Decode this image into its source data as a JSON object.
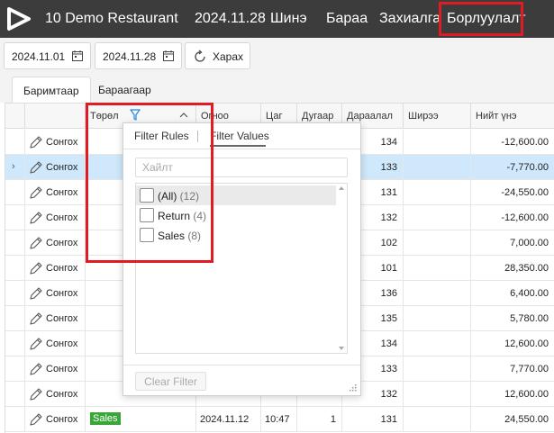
{
  "header": {
    "app_title": "10 Demo Restaurant",
    "date": "2024.11.28",
    "nav": [
      {
        "label": "Шинэ"
      },
      {
        "label": "Бараа"
      },
      {
        "label": "Захиалга"
      },
      {
        "label": "Борлуулалт"
      }
    ],
    "active_nav_index": 3
  },
  "toolbar": {
    "start_date": "2024.11.01",
    "end_date": "2024.11.28",
    "refresh_label": "Харах"
  },
  "tabs": [
    {
      "label": "Баримтаар",
      "active": true
    },
    {
      "label": "Бараагаар",
      "active": false
    }
  ],
  "grid": {
    "columns": [
      "",
      "",
      "Төрөл",
      "Огноо",
      "Цаг",
      "Дугаар",
      "Дараалал",
      "Ширээ",
      "Нийт үнэ"
    ],
    "edit_label": "Сонгох",
    "rows": [
      {
        "table": "134",
        "total": "-12,600.00"
      },
      {
        "table": "133",
        "total": "-7,770.00",
        "selected": true
      },
      {
        "table": "131",
        "total": "-24,550.00"
      },
      {
        "table": "132",
        "total": "-12,600.00"
      },
      {
        "table": "102",
        "total": "7,000.00"
      },
      {
        "table": "101",
        "total": "28,350.00"
      },
      {
        "table": "136",
        "total": "6,400.00"
      },
      {
        "table": "135",
        "total": "5,780.00"
      },
      {
        "table": "134",
        "total": "12,600.00"
      },
      {
        "table": "133",
        "total": "7,770.00"
      },
      {
        "table": "132",
        "total": "12,600.00"
      },
      {
        "type": "Sales",
        "date": "2024.11.12",
        "time": "10:47",
        "number": "1",
        "table": "131",
        "total": "24,550.00"
      }
    ]
  },
  "filter_popup": {
    "tab_rules": "Filter Rules",
    "tab_values": "Filter Values",
    "search_placeholder": "Хайлт",
    "items": [
      {
        "label": "(All)",
        "count": "(12)"
      },
      {
        "label": "Return",
        "count": "(4)"
      },
      {
        "label": "Sales",
        "count": "(8)"
      }
    ],
    "clear_label": "Clear Filter"
  },
  "colors": {
    "topbar": "#3c3c3c",
    "highlight": "#e01b24",
    "selected_row": "#cfe8fb",
    "sales_badge": "#3aa63a",
    "filter_icon": "#1e88e5"
  }
}
